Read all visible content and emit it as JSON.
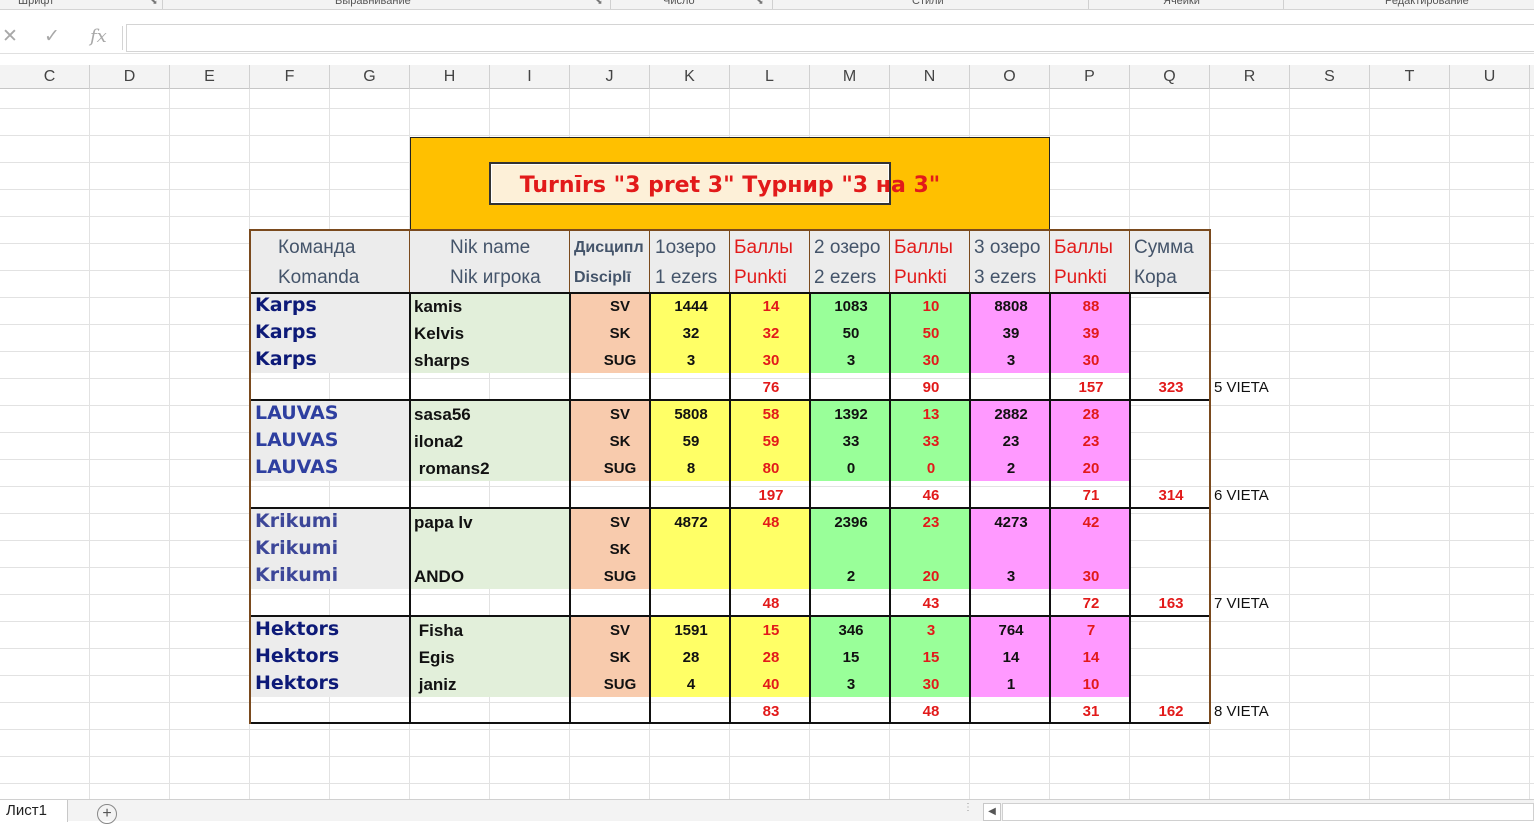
{
  "ribbon": {
    "groups": [
      {
        "label": "Шрифт",
        "name": "ribbon-group-font"
      },
      {
        "label": "Выравнивание",
        "name": "ribbon-group-alignment"
      },
      {
        "label": "Число",
        "name": "ribbon-group-number"
      },
      {
        "label": "Стили",
        "name": "ribbon-group-styles"
      },
      {
        "label": "Ячейки",
        "name": "ribbon-group-cells"
      },
      {
        "label": "Редактирование",
        "name": "ribbon-group-editing"
      }
    ]
  },
  "formula_bar": {
    "cancel_icon": "✕",
    "enter_icon": "✓",
    "fx_label": "fx",
    "value": ""
  },
  "columns": [
    "C",
    "D",
    "E",
    "F",
    "G",
    "H",
    "I",
    "J",
    "K",
    "L",
    "M",
    "N",
    "O",
    "P",
    "Q",
    "R",
    "S",
    "T",
    "U"
  ],
  "title": "Turnīrs \"3 pret 3\" Турнир \"3 на 3\"",
  "headers": {
    "team": [
      "Команда",
      "Komanda"
    ],
    "nick": [
      "Nik name",
      "Nik  игрока"
    ],
    "disc": [
      "Дисципл",
      "Disciplī"
    ],
    "lake1": [
      "1озеро",
      "1 ezers"
    ],
    "pts1": [
      "Баллы",
      "Punkti"
    ],
    "lake2": [
      "2 озеро",
      "2 ezers"
    ],
    "pts2": [
      "Баллы",
      "Punkti"
    ],
    "lake3": [
      "3 озеро",
      "3 ezers"
    ],
    "pts3": [
      "Баллы",
      "Punkti"
    ],
    "sum": [
      "Сумма",
      "Кора"
    ]
  },
  "teams": [
    {
      "name": "Karps",
      "rows": [
        {
          "team": "Karps",
          "nick": "kamis",
          "disc": "SV",
          "l1": "1444",
          "p1": "14",
          "l2": "1083",
          "p2": "10",
          "l3": "8808",
          "p3": "88"
        },
        {
          "team": "Karps",
          "nick": "Kelvis",
          "disc": "SK",
          "l1": "32",
          "p1": "32",
          "l2": "50",
          "p2": "50",
          "l3": "39",
          "p3": "39"
        },
        {
          "team": "Karps",
          "nick": "sharps",
          "disc": "SUG",
          "l1": "3",
          "p1": "30",
          "l2": "3",
          "p2": "30",
          "l3": "3",
          "p3": "30"
        }
      ],
      "totals": {
        "p1": "76",
        "p2": "90",
        "p3": "157",
        "sum": "323",
        "place": "5 VIETA"
      }
    },
    {
      "name": "LAUVAS",
      "rows": [
        {
          "team": "LAUVAS",
          "nick": "sasa56",
          "disc": "SV",
          "l1": "5808",
          "p1": "58",
          "l2": "1392",
          "p2": "13",
          "l3": "2882",
          "p3": "28"
        },
        {
          "team": "LAUVAS",
          "nick": "ilona2",
          "disc": "SK",
          "l1": "59",
          "p1": "59",
          "l2": "33",
          "p2": "33",
          "l3": "23",
          "p3": "23"
        },
        {
          "team": "LAUVAS",
          "nick": " romans2",
          "disc": "SUG",
          "l1": "8",
          "p1": "80",
          "l2": "0",
          "p2": "0",
          "l3": "2",
          "p3": "20"
        }
      ],
      "totals": {
        "p1": "197",
        "p2": "46",
        "p3": "71",
        "sum": "314",
        "place": "6 VIETA"
      }
    },
    {
      "name": "Krikumi",
      "rows": [
        {
          "team": "Krikumi",
          "nick": "papa lv",
          "disc": "SV",
          "l1": "4872",
          "p1": "48",
          "l2": "2396",
          "p2": "23",
          "l3": "4273",
          "p3": "42"
        },
        {
          "team": "Krikumi",
          "nick": "",
          "disc": "SK",
          "l1": "",
          "p1": "",
          "l2": "",
          "p2": "",
          "l3": "",
          "p3": ""
        },
        {
          "team": "Krikumi",
          "nick": "ANDO",
          "disc": "SUG",
          "l1": "",
          "p1": "",
          "l2": "2",
          "p2": "20",
          "l3": "3",
          "p3": "30"
        }
      ],
      "totals": {
        "p1": "48",
        "p2": "43",
        "p3": "72",
        "sum": "163",
        "place": "7 VIETA"
      }
    },
    {
      "name": "Hektors",
      "rows": [
        {
          "team": "Hektors",
          "nick": " Fisha",
          "disc": "SV",
          "l1": "1591",
          "p1": "15",
          "l2": "346",
          "p2": "3",
          "l3": "764",
          "p3": "7"
        },
        {
          "team": "Hektors",
          "nick": " Egis",
          "disc": "SK",
          "l1": "28",
          "p1": "28",
          "l2": "15",
          "p2": "15",
          "l3": "14",
          "p3": "14"
        },
        {
          "team": "Hektors",
          "nick": " janiz",
          "disc": "SUG",
          "l1": "4",
          "p1": "40",
          "l2": "3",
          "p2": "30",
          "l3": "1",
          "p3": "10"
        }
      ],
      "totals": {
        "p1": "83",
        "p2": "48",
        "p3": "31",
        "sum": "162",
        "place": "8 VIETA"
      }
    }
  ],
  "sheet_tabs": [
    "Лист1"
  ],
  "colors": {
    "title_bg": "#ffc000",
    "title_box_bg": "#fdf0d8",
    "team_bg": "#ececec",
    "nick_bg": "#e2efda",
    "disc_bg": "#f8cbad",
    "lake1_bg": "#ffff66",
    "lake2_bg": "#99ff99",
    "lake3_bg": "#ff99ff",
    "red_text": "#e21a1a"
  }
}
